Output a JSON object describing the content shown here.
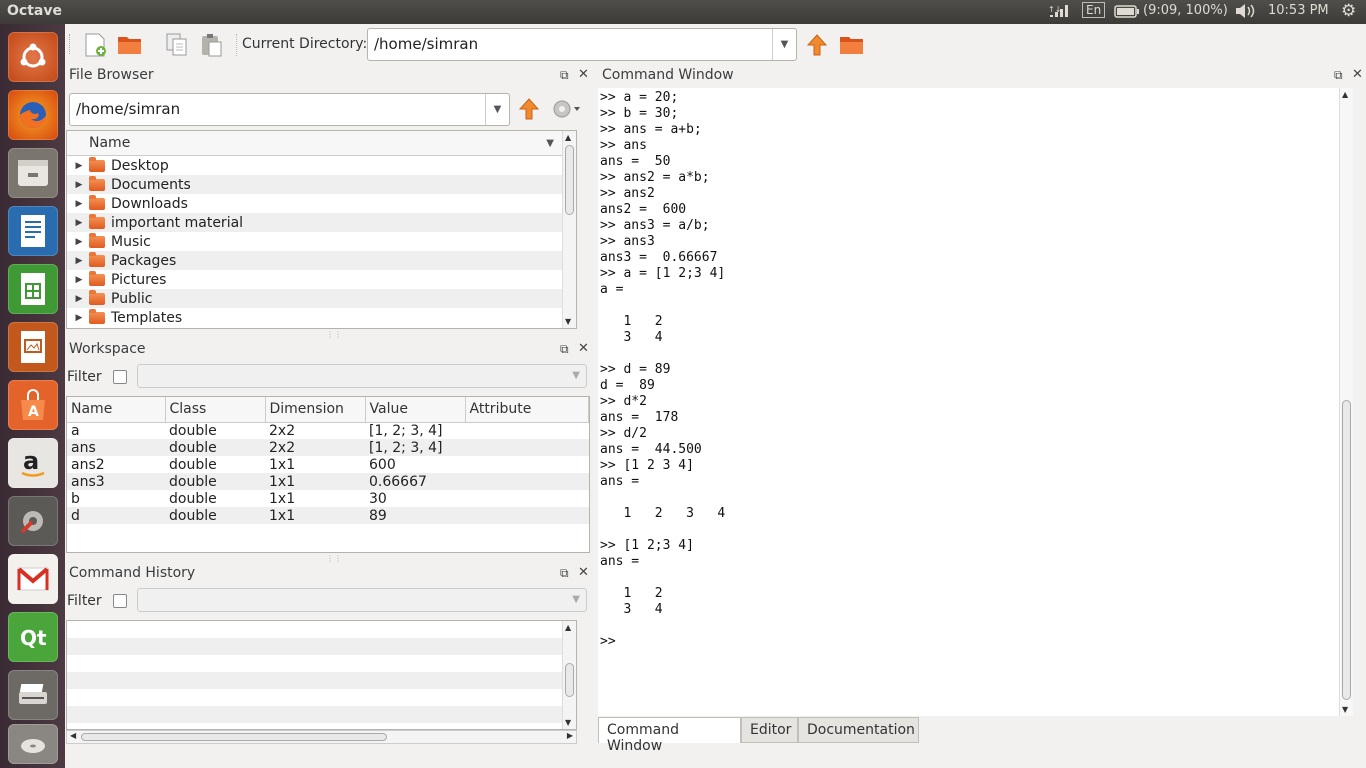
{
  "topbar": {
    "app_title": "Octave",
    "keyboard_layout": "En",
    "battery": "(9:09, 100%)",
    "time": "10:53 PM"
  },
  "launcher": {
    "items": [
      "ubuntu-dash",
      "firefox",
      "files",
      "writer",
      "calc",
      "impress",
      "software-center",
      "amazon",
      "system-settings",
      "gmail",
      "qt-creator",
      "scanner"
    ]
  },
  "toolbar": {
    "current_directory_label": "Current Directory:",
    "current_directory_value": "/home/simran"
  },
  "file_browser": {
    "title": "File Browser",
    "path": "/home/simran",
    "column_header": "Name",
    "items": [
      "Desktop",
      "Documents",
      "Downloads",
      "important material",
      "Music",
      "Packages",
      "Pictures",
      "Public",
      "Templates"
    ]
  },
  "workspace": {
    "title": "Workspace",
    "filter_label": "Filter",
    "columns": [
      "Name",
      "Class",
      "Dimension",
      "Value",
      "Attribute"
    ],
    "rows": [
      [
        "a",
        "double",
        "2x2",
        "[1, 2; 3, 4]",
        ""
      ],
      [
        "ans",
        "double",
        "2x2",
        "[1, 2; 3, 4]",
        ""
      ],
      [
        "ans2",
        "double",
        "1x1",
        "600",
        ""
      ],
      [
        "ans3",
        "double",
        "1x1",
        "0.66667",
        ""
      ],
      [
        "b",
        "double",
        "1x1",
        "30",
        ""
      ],
      [
        "d",
        "double",
        "1x1",
        "89",
        ""
      ]
    ]
  },
  "command_history": {
    "title": "Command History",
    "filter_label": "Filter"
  },
  "command_window": {
    "title": "Command Window",
    "lines": [
      ">> a = 20;",
      ">> b = 30;",
      ">> ans = a+b;",
      ">> ans",
      "ans =  50",
      ">> ans2 = a*b;",
      ">> ans2",
      "ans2 =  600",
      ">> ans3 = a/b;",
      ">> ans3",
      "ans3 =  0.66667",
      ">> a = [1 2;3 4]",
      "a =",
      "",
      "   1   2",
      "   3   4",
      "",
      ">> d = 89",
      "d =  89",
      ">> d*2",
      "ans =  178",
      ">> d/2",
      "ans =  44.500",
      ">> [1 2 3 4]",
      "ans =",
      "",
      "   1   2   3   4",
      "",
      ">> [1 2;3 4]",
      "ans =",
      "",
      "   1   2",
      "   3   4",
      "",
      ">>"
    ]
  },
  "tabs": [
    "Command Window",
    "Editor",
    "Documentation"
  ],
  "colors": {
    "accent_orange": "#e8601c",
    "launcher_bg": "#3f2e36",
    "topbar_bg": "#3c3b37"
  }
}
